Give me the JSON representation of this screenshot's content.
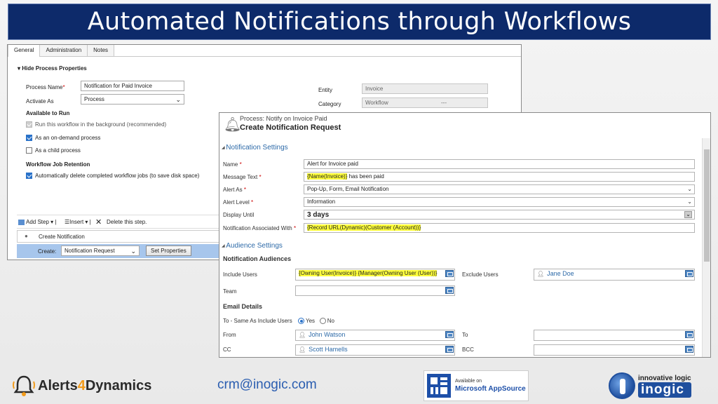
{
  "title": "Automated Notifications through Workflows",
  "back_window": {
    "tabs": [
      "General",
      "Administration",
      "Notes"
    ],
    "hide_props": "Hide Process Properties",
    "process_name_label": "Process Name",
    "process_name_value": "Notification for Paid Invoice",
    "activate_as_label": "Activate As",
    "activate_as_value": "Process",
    "entity_label": "Entity",
    "entity_value": "Invoice",
    "category_label": "Category",
    "category_value": "Workflow",
    "category_extra": "---",
    "available_to_run": "Available to Run",
    "opt_background": "Run this workflow in the background (recommended)",
    "opt_ondemand": "As an on-demand process",
    "opt_child": "As a child process",
    "retention": "Workflow Job Retention",
    "opt_delete": "Automatically delete completed workflow jobs (to save disk space)",
    "add_step": "Add Step",
    "insert": "Insert",
    "delete_step": "Delete this step.",
    "step_name": "Create Notification",
    "create_label": "Create:",
    "create_value": "Notification Request",
    "set_properties": "Set Properties"
  },
  "front_window": {
    "process_line": "Process: Notify on Invoice Paid",
    "header": "Create Notification Request",
    "notification_settings": "Notification Settings",
    "name_label": "Name",
    "name_value": "Alert for Invoice paid",
    "message_label": "Message Text",
    "message_hl": "{Name(Invoice)}",
    "message_rest": "has been paid",
    "alert_as_label": "Alert As",
    "alert_as_value": "Pop-Up, Form, Email Notification",
    "alert_level_label": "Alert Level",
    "alert_level_value": "Information",
    "display_until_label": "Display Until",
    "display_until_value": "3 days",
    "assoc_label": "Notification Associated With",
    "assoc_value": "{Record URL(Dynamic)(Customer (Account))}",
    "audience_settings": "Audience Settings",
    "notification_audiences": "Notification Audiences",
    "include_users_label": "Include Users",
    "include_users_value": "{Owning User(Invoice)} {Manager(Owning User (User))}",
    "exclude_users_label": "Exclude Users",
    "exclude_users_value": "Jane Doe",
    "team_label": "Team",
    "email_details": "Email Details",
    "to_same_label": "To - Same As Include Users",
    "yes": "Yes",
    "no": "No",
    "from_label": "From",
    "from_value": "John Watson",
    "to_label": "To",
    "cc_label": "CC",
    "cc_value": "Scott Hamells",
    "bcc_label": "BCC"
  },
  "footer": {
    "brand_a": "Alerts",
    "brand_4": "4",
    "brand_b": "Dynamics",
    "email": "crm@inogic.com",
    "available_on": "Available on",
    "appsource": "Microsoft AppSource",
    "tagline": "innovative logic",
    "inogic": "inogic"
  },
  "colors": {
    "title_bg": "#0d2a6a",
    "highlight": "#ffff3b",
    "link_blue": "#2d6aa8",
    "brand_orange": "#f29b1b"
  }
}
